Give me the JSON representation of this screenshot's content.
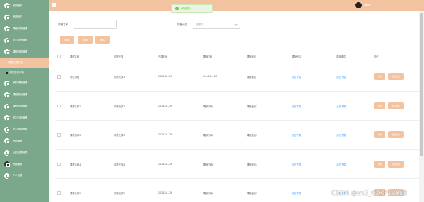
{
  "header": {
    "title": "",
    "username": "管理员"
  },
  "toast": {
    "text": "添加成功"
  },
  "sidebar": {
    "items": [
      {
        "label": "系统首页",
        "type": "main"
      },
      {
        "label": "系统用户",
        "type": "main"
      },
      {
        "label": "课程分类管理",
        "type": "main"
      },
      {
        "label": "学习阶段管理",
        "type": "main"
      },
      {
        "label": "课程信息管理",
        "type": "main"
      },
      {
        "label": "课程信息列表",
        "type": "sub",
        "active": true
      },
      {
        "label": "课程信息审核",
        "type": "sub",
        "cursor": true
      },
      {
        "label": "我的课程管理",
        "type": "main"
      },
      {
        "label": "课程笔记管理",
        "type": "main"
      },
      {
        "label": "课程反馈管理",
        "type": "main"
      },
      {
        "label": "学习计划管理",
        "type": "main"
      },
      {
        "label": "学习资源管理",
        "type": "main"
      },
      {
        "label": "系统管理",
        "type": "main"
      },
      {
        "label": "公告信息管理",
        "type": "main"
      },
      {
        "label": "资源管理",
        "type": "main",
        "dark": true
      },
      {
        "label": "个人信息",
        "type": "main"
      }
    ]
  },
  "search": {
    "course_name_label": "课程名称",
    "course_name_placeholder": "",
    "category_label": "课程分类",
    "category_placeholder": "请选择"
  },
  "actions": {
    "search": "查询",
    "add": "新增",
    "delete": "删除"
  },
  "table": {
    "headers": [
      "课程名称",
      "课程分类",
      "开课时间",
      "课程时间",
      "课程地点",
      "课程资料",
      "课程课件",
      "操作"
    ],
    "rows": [
      {
        "name": "测试课程",
        "category": "课程分类1",
        "date": "2024-01-29",
        "time": "10:00-11:30",
        "location": "课程地点",
        "material": "点击下载",
        "courseware": "点击下载",
        "view": "详情",
        "change": "修改信息"
      },
      {
        "name": "课程名称2",
        "category": "课程分类2",
        "date": "2024-01-29",
        "time": "课程时间2",
        "location": "课程地点2",
        "material": "点击下载",
        "courseware": "点击下载",
        "view": "详情",
        "change": "修改信息"
      },
      {
        "name": "课程名称3",
        "category": "课程分类3",
        "date": "2024-01-29",
        "time": "课程时间3",
        "location": "课程地点3",
        "material": "点击下载",
        "courseware": "点击下载",
        "view": "详情",
        "change": "修改信息"
      },
      {
        "name": "课程名称4",
        "category": "课程分类4",
        "date": "2024-01-29",
        "time": "课程时间4",
        "location": "课程地点4",
        "material": "点击下载",
        "courseware": "点击下载",
        "view": "详情",
        "change": "修改信息"
      },
      {
        "name": "课程名称5",
        "category": "课程分类5",
        "date": "2024-01-29",
        "time": "课程时间5",
        "location": "课程地点5",
        "material": "点击下载",
        "courseware": "点击下载",
        "view": "详情",
        "change": "修改信息"
      }
    ]
  },
  "watermark": "CSDN @vx2_CXKF10088"
}
